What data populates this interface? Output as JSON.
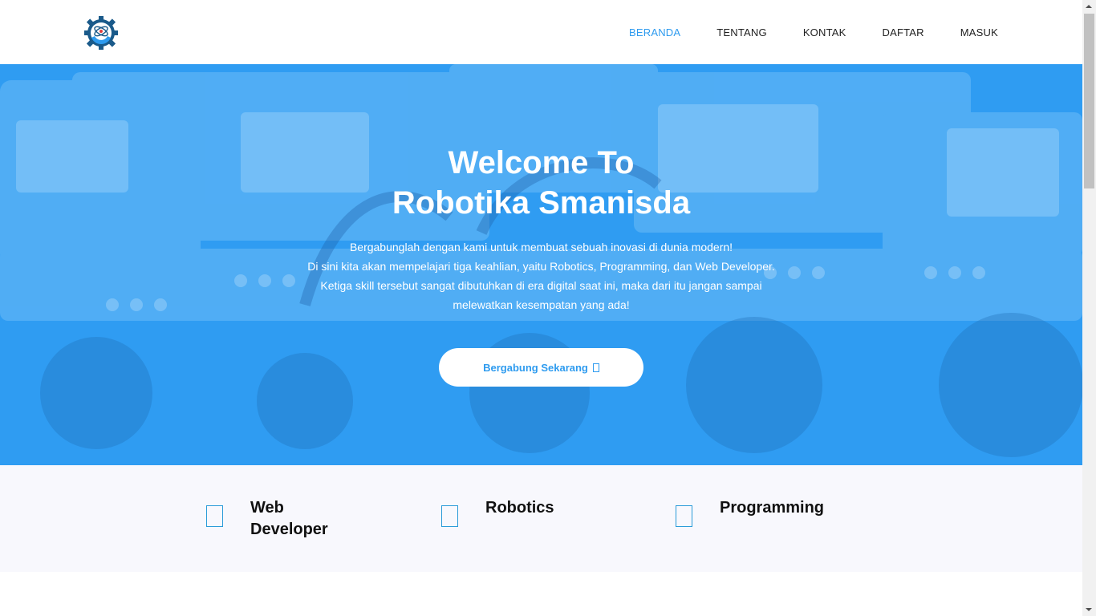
{
  "header": {
    "logo_name": "robotika-gear-logo",
    "nav": [
      {
        "label": "BERANDA",
        "active": true
      },
      {
        "label": "TENTANG",
        "active": false
      },
      {
        "label": "KONTAK",
        "active": false
      },
      {
        "label": "DAFTAR",
        "active": false
      },
      {
        "label": "MASUK",
        "active": false
      }
    ]
  },
  "hero": {
    "title_line1": "Welcome To",
    "title_line2": "Robotika Smanisda",
    "desc_lines": [
      "Bergabunglah dengan kami untuk membuat sebuah inovasi di dunia modern!",
      "Di sini kita akan mempelajari tiga keahlian, yaitu Robotics, Programming, dan Web Developer.",
      "Ketiga skill tersebut sangat dibutuhkan di era digital saat ini, maka dari itu jangan sampai",
      "melewatkan kesempatan yang ada!"
    ],
    "button_label": "Bergabung Sekarang",
    "button_icon": "arrow-right-icon",
    "overlay_color": "#2b9af3"
  },
  "features": [
    {
      "label": "Web Developer",
      "icon": "code-icon"
    },
    {
      "label": "Robotics",
      "icon": "robot-icon"
    },
    {
      "label": "Programming",
      "icon": "terminal-icon"
    }
  ],
  "colors": {
    "accent": "#2e9bef",
    "features_bg": "#f8f8fd"
  }
}
